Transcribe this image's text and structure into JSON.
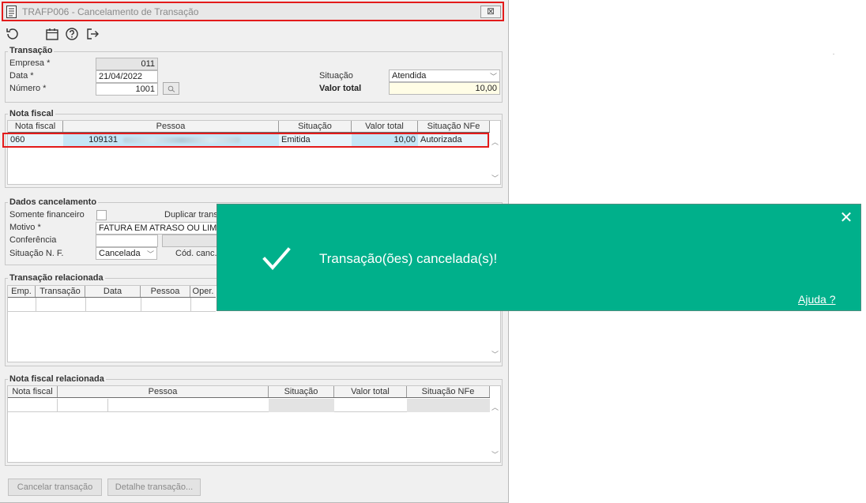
{
  "window": {
    "title": "TRAFP006 - Cancelamento de Transação",
    "close": "⊠"
  },
  "toolbar": {
    "icons": [
      "refresh-icon",
      "calendar-icon",
      "help-icon",
      "exit-icon"
    ]
  },
  "transacao": {
    "group_title": "Transação",
    "empresa_label": "Empresa *",
    "empresa_value": "011",
    "data_label": "Data *",
    "data_value": "21/04/2022",
    "numero_label": "Número *",
    "numero_value": "1001",
    "situacao_label": "Situação",
    "situacao_value": "Atendida",
    "valor_label": "Valor total",
    "valor_value": "10,00"
  },
  "nota_fiscal": {
    "group_title": "Nota fiscal",
    "columns": [
      "Nota fiscal",
      "Pessoa",
      "Situação",
      "Valor total",
      "Situação NFe"
    ],
    "row": {
      "nota": "060",
      "pessoa_code": "109131",
      "situacao": "Emitida",
      "valor": "10,00",
      "situacao_nfe": "Autorizada"
    }
  },
  "dados": {
    "group_title": "Dados cancelamento",
    "somente_label": "Somente financeiro",
    "duplicar_label": "Duplicar trans",
    "motivo_label": "Motivo *",
    "motivo_value": "FATURA EM ATRASO OU LIMITE",
    "conferencia_label": "Conferência",
    "situacao_nf_label": "Situação N. F.",
    "situacao_nf_value": "Cancelada",
    "cod_label": "Cód. canc."
  },
  "transacao_rel": {
    "group_title": "Transação relacionada",
    "columns": [
      "Emp.",
      "Transação",
      "Data",
      "Pessoa",
      "Oper."
    ]
  },
  "nota_rel": {
    "group_title": "Nota fiscal relacionada",
    "columns": [
      "Nota fiscal",
      "Pessoa",
      "Situação",
      "Valor total",
      "Situação NFe"
    ]
  },
  "buttons": {
    "cancelar": "Cancelar transação",
    "detalhe": "Detalhe transação..."
  },
  "toast": {
    "message": "Transação(ões) cancelada(s)!",
    "help": "Ajuda ?",
    "close": "✕",
    "color": "#00b08b"
  }
}
